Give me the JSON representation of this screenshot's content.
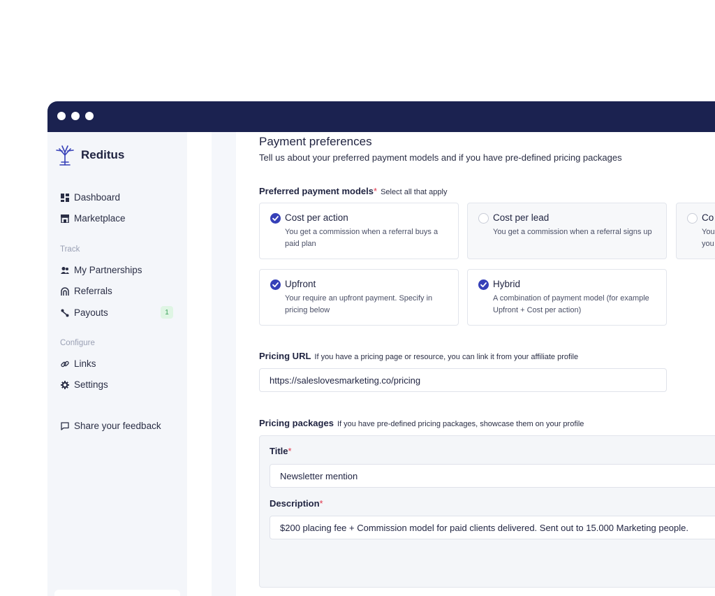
{
  "app": {
    "name": "Reditus"
  },
  "sidebar": {
    "items": [
      {
        "label": "Dashboard",
        "icon": "grid-icon"
      },
      {
        "label": "Marketplace",
        "icon": "store-icon"
      }
    ],
    "track_label": "Track",
    "track_items": [
      {
        "label": "My Partnerships",
        "icon": "people-icon"
      },
      {
        "label": "Referrals",
        "icon": "referral-icon"
      },
      {
        "label": "Payouts",
        "icon": "payout-icon",
        "badge": "1"
      }
    ],
    "configure_label": "Configure",
    "configure_items": [
      {
        "label": "Links",
        "icon": "link-icon"
      },
      {
        "label": "Settings",
        "icon": "gear-icon"
      }
    ],
    "feedback_label": "Share your feedback"
  },
  "main": {
    "title": "Payment preferences",
    "subtitle": "Tell us about your preferred payment models and if you have pre-defined pricing packages",
    "models_label": "Preferred payment models",
    "models_required": "*",
    "models_hint": "Select all that apply",
    "models": [
      {
        "title": "Cost per action",
        "desc": "You get a commission when a referral buys a paid plan",
        "selected": true
      },
      {
        "title": "Cost per lead",
        "desc": "You get a commission when a referral signs up",
        "selected": false
      },
      {
        "title": "Co",
        "desc": "You you",
        "selected": false
      },
      {
        "title": "Upfront",
        "desc": "Your require an upfront payment. Specify in pricing below",
        "selected": true
      },
      {
        "title": "Hybrid",
        "desc": "A combination of payment model (for example Upfront + Cost per action)",
        "selected": true
      }
    ],
    "pricing_url_label": "Pricing URL",
    "pricing_url_hint": "If you have a pricing page or resource, you can link it from your affiliate profile",
    "pricing_url_value": "https://saleslovesmarketing.co/pricing",
    "packages_label": "Pricing packages",
    "packages_hint": "If you have pre-defined pricing packages, showcase them on your profile",
    "package": {
      "title_label": "Title",
      "title_value": "Newsletter mention",
      "desc_label": "Description",
      "desc_value": "$200 placing fee + Commission model for paid clients delivered. Sent out to 15.000 Marketing people.",
      "required": "*"
    }
  },
  "colors": {
    "titlebar": "#1b2250",
    "accent": "#3640b8",
    "required": "#e0364b"
  }
}
